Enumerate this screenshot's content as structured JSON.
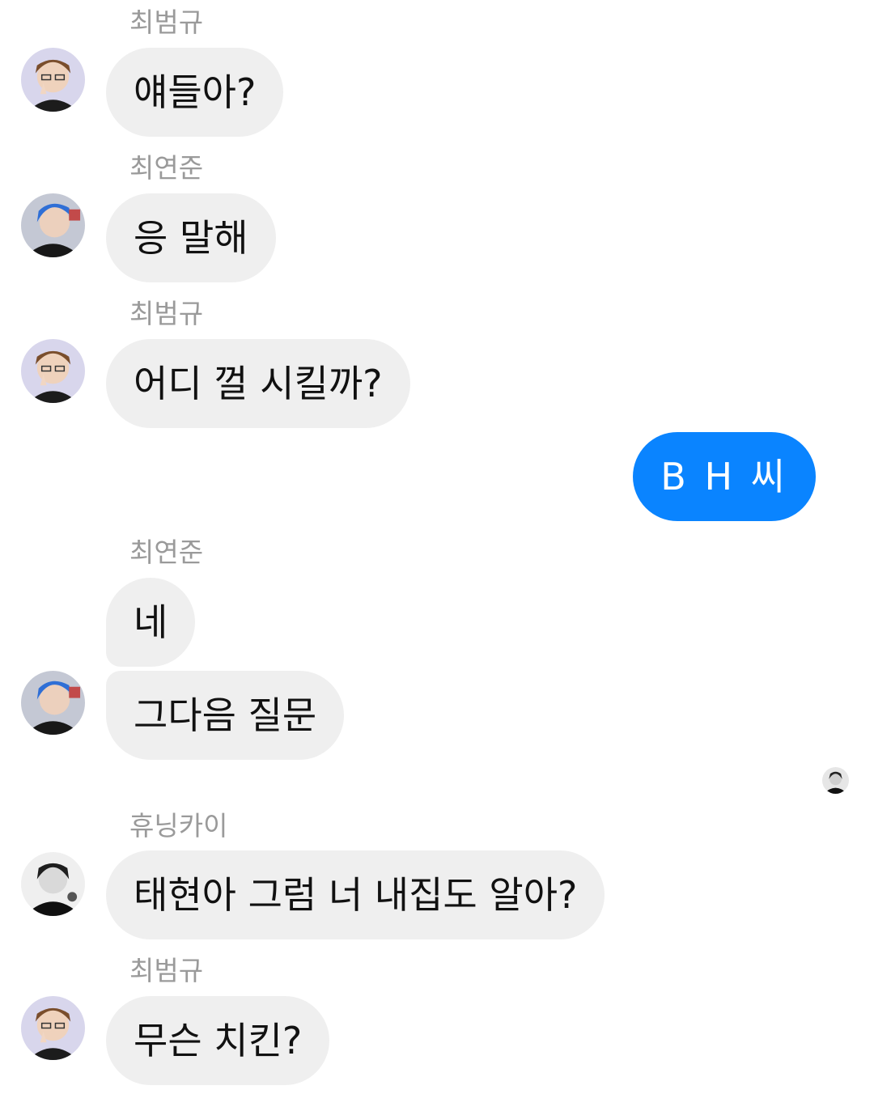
{
  "messages": [
    {
      "sender": "최범규",
      "text": "얘들아?"
    },
    {
      "sender": "최연준",
      "text": "응 말해"
    },
    {
      "sender": "최범규",
      "text": "어디 껄 시킬까?"
    },
    {
      "sender": "",
      "text": "B H 씨"
    },
    {
      "sender": "최연준",
      "text": "네"
    },
    {
      "sender": "",
      "text": "그다음 질문"
    },
    {
      "sender": "휴닝카이",
      "text": "태현아 그럼 너 내집도 알아?"
    },
    {
      "sender": "최범규",
      "text": "무슨 치킨?"
    }
  ],
  "colors": {
    "outgoing_bubble": "#0a84ff",
    "incoming_bubble": "#efefef",
    "sender_name": "#9a9a9a"
  },
  "icons": {
    "avatar_beomgyu": "avatar-icon",
    "avatar_yeonjun": "avatar-icon",
    "avatar_hueningkai": "avatar-icon",
    "read_receipt": "seen-avatar-icon"
  }
}
